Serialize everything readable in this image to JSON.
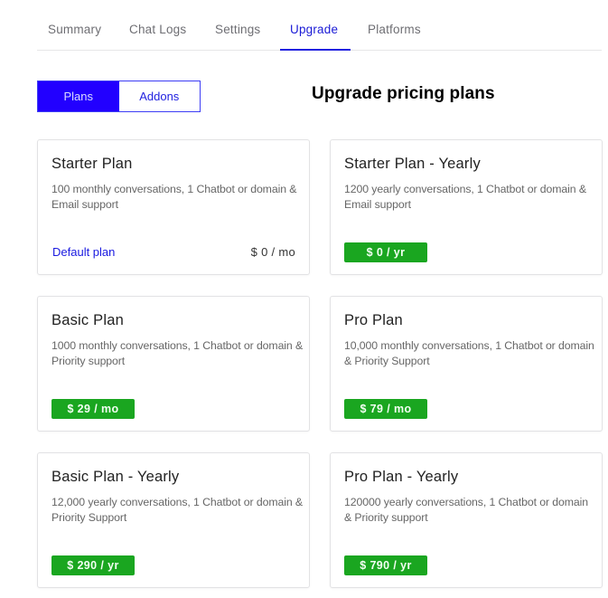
{
  "tabs": [
    {
      "label": "Summary",
      "active": false
    },
    {
      "label": "Chat Logs",
      "active": false
    },
    {
      "label": "Settings",
      "active": false
    },
    {
      "label": "Upgrade",
      "active": true
    },
    {
      "label": "Platforms",
      "active": false
    }
  ],
  "toggle": {
    "plans_label": "Plans",
    "addons_label": "Addons",
    "selected": "Plans"
  },
  "page_heading": "Upgrade pricing plans",
  "colors": {
    "accent_blue": "#2200ff",
    "tab_active": "#1a1ad6",
    "price_green": "#1aa620"
  },
  "plans": [
    {
      "title": "Starter Plan",
      "description": "100 monthly conversations, 1 Chatbot or domain & Email support",
      "default_label": "Default plan",
      "price": "$ 0 / mo"
    },
    {
      "title": "Starter Plan - Yearly",
      "description": "1200 yearly conversations, 1 Chatbot or domain & Email support",
      "price": "$ 0 / yr"
    },
    {
      "title": "Basic Plan",
      "description": "1000 monthly conversations, 1 Chatbot or domain & Priority support",
      "price": "$ 29 / mo"
    },
    {
      "title": "Pro Plan",
      "description": "10,000 monthly conversations, 1 Chatbot or domain & Priority Support",
      "price": "$ 79 / mo"
    },
    {
      "title": "Basic Plan - Yearly",
      "description": "12,000 yearly conversations, 1 Chatbot or domain & Priority Support",
      "price": "$ 290 / yr"
    },
    {
      "title": "Pro Plan - Yearly",
      "description": "120000 yearly conversations, 1 Chatbot or domain & Priority support",
      "price": "$ 790 / yr"
    }
  ]
}
